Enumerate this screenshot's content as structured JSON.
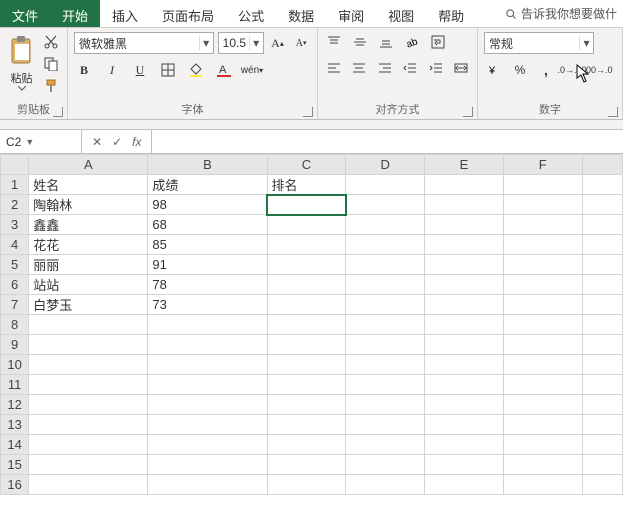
{
  "menu": {
    "file": "文件",
    "tabs": [
      "开始",
      "插入",
      "页面布局",
      "公式",
      "数据",
      "审阅",
      "视图",
      "帮助"
    ],
    "active": 0,
    "tell_me": "告诉我你想要做什"
  },
  "ribbon": {
    "clipboard": {
      "paste": "粘贴",
      "label": "剪贴板"
    },
    "font": {
      "name": "微软雅黑",
      "size": "10.5",
      "label": "字体"
    },
    "alignment": {
      "label": "对齐方式"
    },
    "number": {
      "format": "常规",
      "label": "数字"
    }
  },
  "namebox": {
    "ref": "C2"
  },
  "formula": {
    "fx": "fx",
    "value": ""
  },
  "columns": [
    "A",
    "B",
    "C",
    "D",
    "E",
    "F",
    ""
  ],
  "rows": [
    {
      "n": 1,
      "cells": [
        "姓名",
        "成绩",
        "排名",
        "",
        "",
        "",
        ""
      ]
    },
    {
      "n": 2,
      "cells": [
        "陶翰林",
        "98",
        "",
        "",
        "",
        "",
        ""
      ]
    },
    {
      "n": 3,
      "cells": [
        "鑫鑫",
        "68",
        "",
        "",
        "",
        "",
        ""
      ]
    },
    {
      "n": 4,
      "cells": [
        "花花",
        "85",
        "",
        "",
        "",
        "",
        ""
      ]
    },
    {
      "n": 5,
      "cells": [
        "丽丽",
        "91",
        "",
        "",
        "",
        "",
        ""
      ]
    },
    {
      "n": 6,
      "cells": [
        "站站",
        "78",
        "",
        "",
        "",
        "",
        ""
      ]
    },
    {
      "n": 7,
      "cells": [
        "白梦玉",
        "73",
        "",
        "",
        "",
        "",
        ""
      ]
    },
    {
      "n": 8,
      "cells": [
        "",
        "",
        "",
        "",
        "",
        "",
        ""
      ]
    },
    {
      "n": 9,
      "cells": [
        "",
        "",
        "",
        "",
        "",
        "",
        ""
      ]
    },
    {
      "n": 10,
      "cells": [
        "",
        "",
        "",
        "",
        "",
        "",
        ""
      ]
    },
    {
      "n": 11,
      "cells": [
        "",
        "",
        "",
        "",
        "",
        "",
        ""
      ]
    },
    {
      "n": 12,
      "cells": [
        "",
        "",
        "",
        "",
        "",
        "",
        ""
      ]
    },
    {
      "n": 13,
      "cells": [
        "",
        "",
        "",
        "",
        "",
        "",
        ""
      ]
    },
    {
      "n": 14,
      "cells": [
        "",
        "",
        "",
        "",
        "",
        "",
        ""
      ]
    },
    {
      "n": 15,
      "cells": [
        "",
        "",
        "",
        "",
        "",
        "",
        ""
      ]
    },
    {
      "n": 16,
      "cells": [
        "",
        "",
        "",
        "",
        "",
        "",
        ""
      ]
    }
  ],
  "selected_cell": "C2"
}
